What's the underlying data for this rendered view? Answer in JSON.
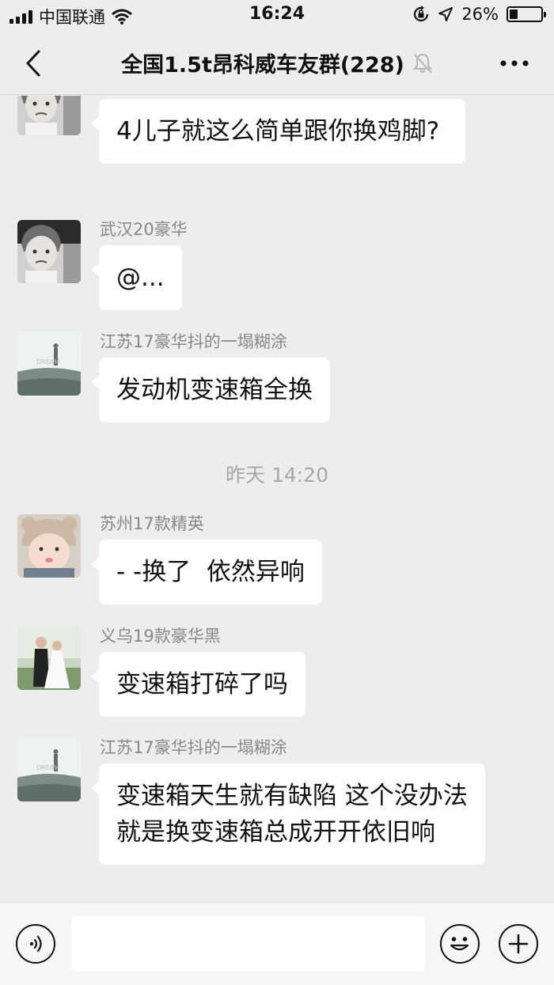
{
  "status_bar": {
    "carrier": "中国联通",
    "time": "16:24",
    "battery_percent": "26%",
    "battery_level": 0.26,
    "icons": [
      "signal-icon",
      "wifi-icon",
      "orientation-lock-icon",
      "location-icon",
      "battery-icon"
    ]
  },
  "nav": {
    "title": "全国1.5t昂科威车友群(228)",
    "icons": [
      "back-arrow-icon",
      "mute-bell-icon",
      "more-icon"
    ]
  },
  "messages": [
    {
      "sender": "",
      "avatar": "grumpy-girl",
      "text": "4儿子就这么简单跟你换鸡脚?"
    },
    {
      "sender": "武汉20豪华",
      "avatar": "grumpy-girl",
      "text": "@..."
    },
    {
      "sender": "江苏17豪华抖的一塌糊涂",
      "avatar": "dream-landscape",
      "text": "发动机变速箱全换"
    },
    {
      "sender": "苏州17款精英",
      "avatar": "baby-bear-hat",
      "text": "- -换了  依然异响"
    },
    {
      "sender": "义乌19款豪华黑",
      "avatar": "wedding-couple",
      "text": "变速箱打碎了吗"
    },
    {
      "sender": "江苏17豪华抖的一塌糊涂",
      "avatar": "dream-landscape",
      "text": "变速箱天生就有缺陷 这个没办法 就是换变速箱总成开开依旧响"
    }
  ],
  "timestamp": "昨天 14:20",
  "input_bar": {
    "placeholder": "",
    "icons": [
      "voice-icon",
      "emoji-icon",
      "plus-icon"
    ]
  },
  "colors": {
    "background": "#ededed",
    "bubble": "#ffffff",
    "sender_text": "#888888",
    "timestamp_text": "#a8a8a8"
  }
}
